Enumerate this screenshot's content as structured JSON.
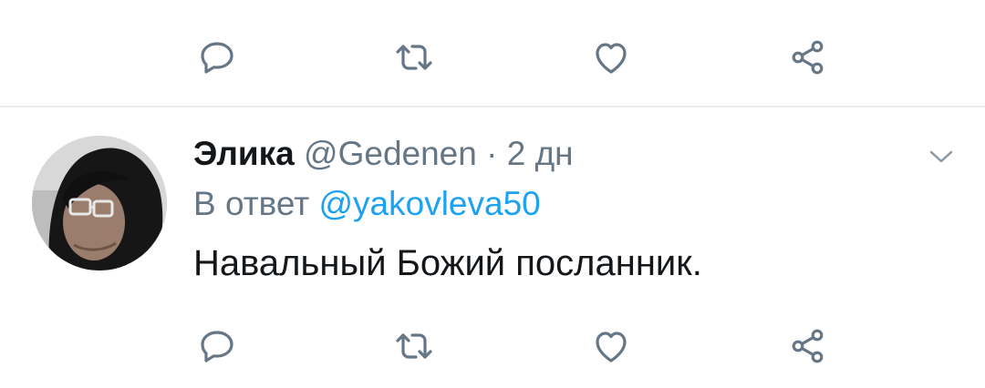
{
  "tweet": {
    "author_name": "Элика",
    "author_handle": "@Gedenen",
    "separator": "·",
    "time": "2 дн",
    "reply_prefix": "В ответ",
    "reply_to": "@yakovleva50",
    "text": "Навальный Божий посланник."
  },
  "icons": {
    "reply": "reply-icon",
    "retweet": "retweet-icon",
    "like": "heart-icon",
    "share": "share-icon",
    "more": "chevron-down-icon"
  },
  "colors": {
    "icon_gray": "#657786",
    "mention_blue": "#1da1f2",
    "text_dark": "#14171a",
    "divider": "#e6ecf0"
  }
}
